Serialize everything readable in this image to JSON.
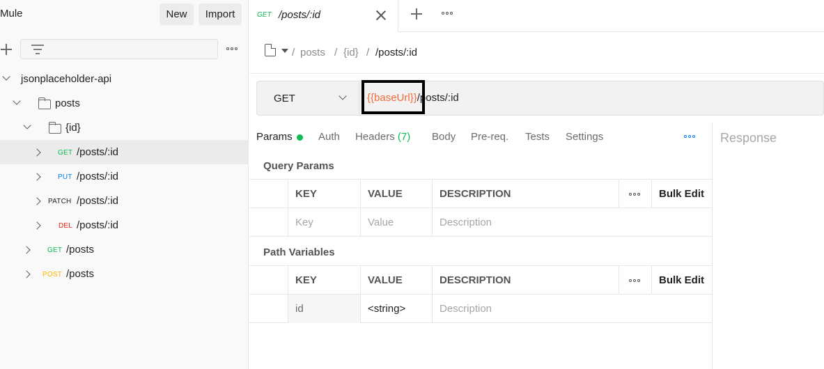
{
  "sidebar": {
    "workspace_title": "Mule",
    "new_label": "New",
    "import_label": "Import",
    "tree": {
      "collection": "jsonplaceholder-api",
      "folder_posts": "posts",
      "folder_id": "{id}",
      "requests": [
        {
          "method": "GET",
          "path": "/posts/:id",
          "color": "#0cbb52"
        },
        {
          "method": "PUT",
          "path": "/posts/:id",
          "color": "#097bed"
        },
        {
          "method": "PATCH",
          "path": "/posts/:id",
          "color": "#212121"
        },
        {
          "method": "DEL",
          "path": "/posts/:id",
          "color": "#eb2013"
        },
        {
          "method": "GET",
          "path": "/posts",
          "color": "#0cbb52"
        },
        {
          "method": "POST",
          "path": "/posts",
          "color": "#ffb400"
        }
      ]
    }
  },
  "tab": {
    "method": "GET",
    "title": "/posts/:id"
  },
  "breadcrumb": {
    "sep1": "/",
    "crumb1": "posts",
    "sep2": "/",
    "crumb2": "{id}",
    "sep3": "/",
    "current": "/posts/:id"
  },
  "url_bar": {
    "method": "GET",
    "base_var": "{{baseUrl}}",
    "path": "/posts/:id"
  },
  "request_tabs": {
    "params": "Params",
    "auth": "Auth",
    "headers": "Headers",
    "headers_count": "(7)",
    "body": "Body",
    "prereq": "Pre-req.",
    "tests": "Tests",
    "settings": "Settings"
  },
  "query_params": {
    "title": "Query Params",
    "headers": {
      "key": "KEY",
      "value": "VALUE",
      "description": "DESCRIPTION",
      "bulk": "Bulk Edit"
    },
    "placeholder": {
      "key": "Key",
      "value": "Value",
      "description": "Description"
    }
  },
  "path_variables": {
    "title": "Path Variables",
    "headers": {
      "key": "KEY",
      "value": "VALUE",
      "description": "DESCRIPTION",
      "bulk": "Bulk Edit"
    },
    "rows": [
      {
        "key": "id",
        "value": "<string>",
        "description": "Description"
      }
    ]
  },
  "response": {
    "label": "Response"
  },
  "colors": {
    "accent": "#f26b3a",
    "success": "#0cbb52"
  }
}
